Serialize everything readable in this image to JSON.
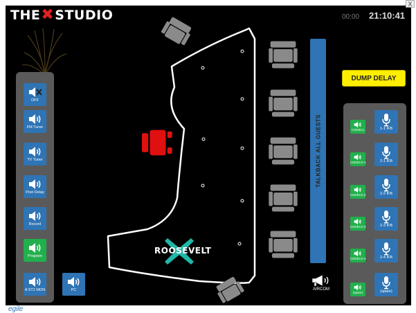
{
  "brand": {
    "part1": "THE",
    "part2": "STUDIO"
  },
  "status": {
    "timer": "00:00",
    "clock": "21:10:41"
  },
  "window": {
    "close_label": "X"
  },
  "footer": {
    "logo_text": "egile"
  },
  "left_panel": {
    "buttons": [
      {
        "label": "OFF",
        "color": "blue",
        "muted": true
      },
      {
        "label": "FM Tuner",
        "color": "blue"
      },
      {
        "label": "TV Tuner",
        "color": "blue"
      },
      {
        "label": "Post Delay",
        "color": "blue"
      },
      {
        "label": "Record",
        "color": "blue"
      },
      {
        "label": "Program",
        "color": "green"
      },
      {
        "label": "A ST1 MON",
        "color": "blue"
      }
    ]
  },
  "pc_button": {
    "label": "PC"
  },
  "talkback": {
    "label": "TALKBACK ALL GUESTS"
  },
  "dump_delay": {
    "label": "DUMP DELAY"
  },
  "aircom": {
    "label": "AIRCOM"
  },
  "desk": {
    "label": "ROOSEVELT"
  },
  "right_panel": {
    "rows": [
      {
        "codec": "CODEC1",
        "ifb": "1-1 IFB"
      },
      {
        "codec": "CODEC2-1",
        "ifb": "2-1 IFB"
      },
      {
        "codec": "CODEC2-2",
        "ifb": "2-2 IFB"
      },
      {
        "codec": "CODEC2-3",
        "ifb": "2-3 IFB"
      },
      {
        "codec": "CODEC2-4",
        "ifb": "2-4 IFB"
      },
      {
        "codec": "(spare)",
        "ifb": "(spare)"
      }
    ]
  },
  "colors": {
    "blue": "#2f74b4",
    "green": "#22b04c",
    "yellow": "#ffee00",
    "red_chair": "#e01010",
    "gray_chair": "#8a8a8a"
  },
  "icons": {
    "speaker": "speaker-icon",
    "microphone": "microphone-icon",
    "megaphone": "megaphone-icon",
    "chair": "chair-icon"
  }
}
